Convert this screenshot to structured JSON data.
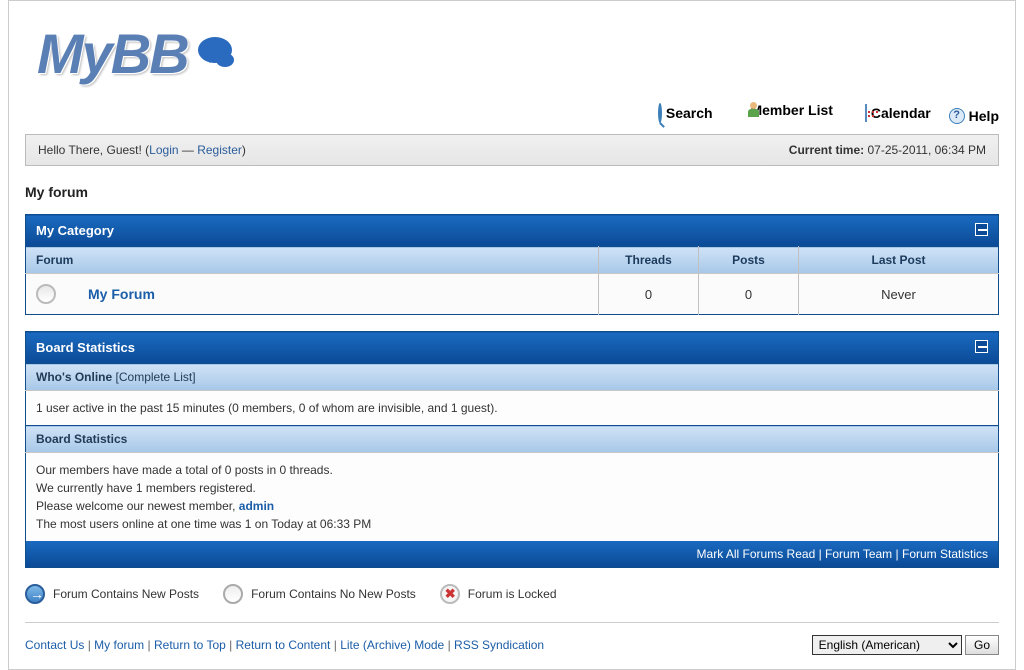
{
  "logo": "MyBB",
  "toplinks": {
    "search": "Search",
    "memberlist": "Member List",
    "calendar": "Calendar",
    "help": "Help"
  },
  "welcome": {
    "greeting": "Hello There, Guest! (",
    "login": "Login",
    "dash": " — ",
    "register": "Register",
    "close": ")",
    "current_time_label": "Current time:",
    "current_time_value": " 07-25-2011, 06:34 PM"
  },
  "breadcrumb": "My forum",
  "category": {
    "title": "My Category",
    "cols": {
      "forum": "Forum",
      "threads": "Threads",
      "posts": "Posts",
      "lastpost": "Last Post"
    },
    "forum_name": "My Forum",
    "threads": "0",
    "posts": "0",
    "lastpost": "Never"
  },
  "stats": {
    "title": "Board Statistics",
    "whos_online_label": "Who's Online",
    "complete_list": "[Complete List]",
    "online_text": "1 user active in the past 15 minutes (0 members, 0 of whom are invisible, and 1 guest).",
    "sub_title": "Board Statistics",
    "line1": "Our members have made a total of 0 posts in 0 threads.",
    "line2": "We currently have 1 members registered.",
    "line3_pre": "Please welcome our newest member, ",
    "admin": "admin",
    "line4": "The most users online at one time was 1 on Today at 06:33 PM"
  },
  "footer_links": {
    "mark_read": "Mark All Forums Read",
    "team": "Forum Team",
    "fstats": "Forum Statistics"
  },
  "legend": {
    "new": "Forum Contains New Posts",
    "nonew": "Forum Contains No New Posts",
    "locked": "Forum is Locked"
  },
  "bottom": {
    "contact": "Contact Us",
    "home": "My forum",
    "top": "Return to Top",
    "content": "Return to Content",
    "lite": "Lite (Archive) Mode",
    "rss": "RSS Syndication",
    "lang_selected": "English (American)",
    "go": "Go"
  }
}
